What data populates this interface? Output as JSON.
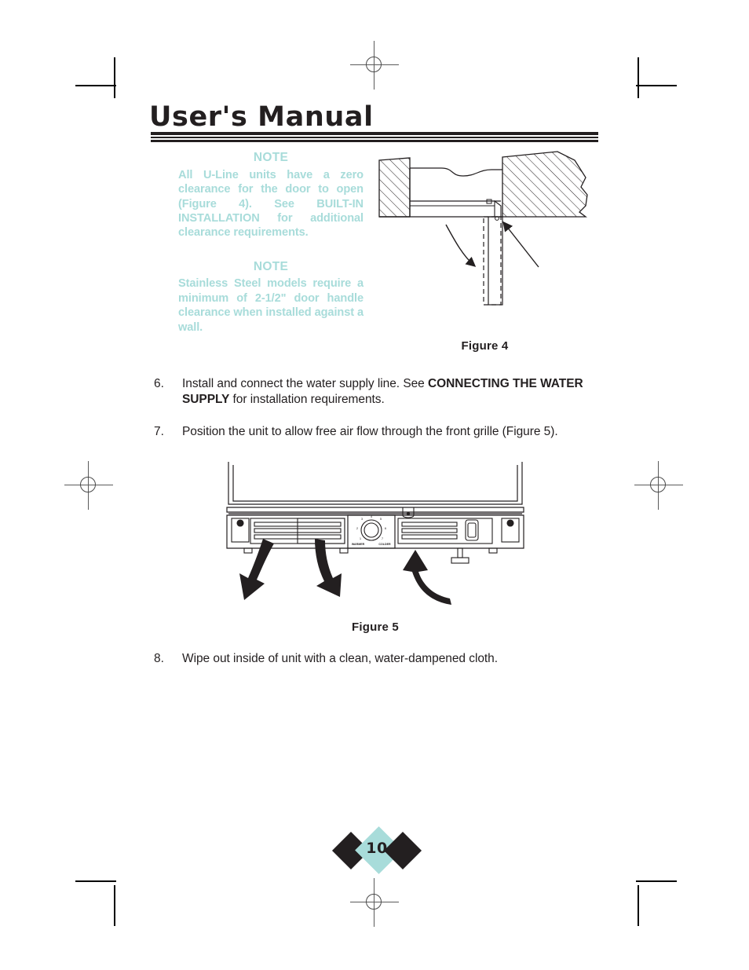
{
  "document": {
    "title": "User's Manual",
    "page_number": "10"
  },
  "notes": [
    {
      "heading": "NOTE",
      "body_html": "All U-Line units have a zero clearance for the door to open (Figure 4). See <b>BUILT-IN INSTALLATION</b> for additional clearance requirements.",
      "body_text": "All U-Line units have a zero clearance for the door to open (Figure 4). See BUILT-IN INSTALLATION for additional clearance requirements."
    },
    {
      "heading": "NOTE",
      "body_html": "Stainless Steel models require a minimum of 2-1/2\" door handle clearance when installed against a wall.",
      "body_text": "Stainless Steel models require a minimum of 2-1/2\" door handle clearance when installed against a wall."
    }
  ],
  "figures": [
    {
      "caption": "Figure 4",
      "description": "Cross-section of cabinet opening showing door swing clearance with hatched cabinet walls and dashed door outline"
    },
    {
      "caption": "Figure 5",
      "description": "Front grille of unit with airflow arrows: warm air exhaust down and out, intake air up and in",
      "dial_labels": {
        "left": "WARMER",
        "right": "COLDER",
        "ticks": [
          "1",
          "2",
          "3",
          "4",
          "5",
          "6",
          "7"
        ]
      }
    }
  ],
  "steps": [
    {
      "number": "6.",
      "html": "Install and connect the water supply line. See <b>CONNECTING THE WATER SUPPLY</b> for installation requirements.",
      "text": "Install and connect the water supply line. See CONNECTING THE WATER SUPPLY for installation requirements.",
      "justified": false
    },
    {
      "number": "7.",
      "html": "Position the unit to allow free air flow through the front grille (Figure 5).",
      "text": "Position the unit to allow free air flow through the front grille (Figure 5).",
      "justified": true
    },
    {
      "number": "8.",
      "html": "Wipe out inside of unit with a clean, water-dampened cloth.",
      "text": "Wipe out inside of unit with a clean, water-dampened cloth.",
      "justified": false
    }
  ],
  "colors": {
    "accent_teal": "#a8dcda",
    "ink_black": "#231f20"
  }
}
